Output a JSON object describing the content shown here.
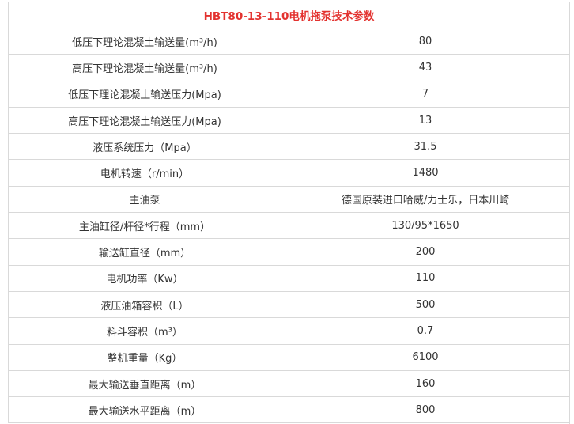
{
  "table": {
    "title": "HBT80-13-110电机拖泵技术参数",
    "rows": [
      {
        "label": "低压下理论混凝土输送量(m³/h)",
        "value": "80"
      },
      {
        "label": "高压下理论混凝土输送量(m³/h)",
        "value": "43"
      },
      {
        "label": "低压下理论混凝土输送压力(Mpa)",
        "value": "7"
      },
      {
        "label": "高压下理论混凝土输送压力(Mpa)",
        "value": "13"
      },
      {
        "label": "液压系统压力（Mpa）",
        "value": "31.5"
      },
      {
        "label": "电机转速（r/min）",
        "value": "1480"
      },
      {
        "label": "主油泵",
        "value": "德国原装进口哈威/力士乐，日本川崎"
      },
      {
        "label": "主油缸径/杆径*行程（mm）",
        "value": "130/95*1650"
      },
      {
        "label": "输送缸直径（mm）",
        "value": "200"
      },
      {
        "label": "电机功率（Kw）",
        "value": "110"
      },
      {
        "label": "液压油箱容积（L）",
        "value": "500"
      },
      {
        "label": "料斗容积（m³）",
        "value": "0.7"
      },
      {
        "label": "整机重量（Kg）",
        "value": "6100"
      },
      {
        "label": "最大输送垂直距离（m）",
        "value": "160"
      },
      {
        "label": "最大输送水平距离（m）",
        "value": "800"
      }
    ]
  },
  "colors": {
    "title": "#e3322f",
    "text": "#333333",
    "border": "#d9d9d9"
  }
}
